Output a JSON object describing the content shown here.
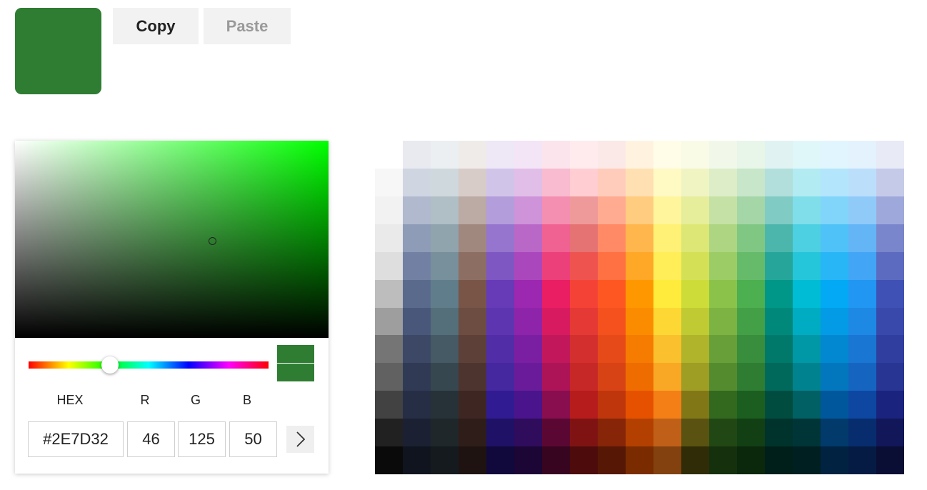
{
  "current_color": "#2E7D32",
  "actions": {
    "copy_label": "Copy",
    "paste_label": "Paste"
  },
  "picker": {
    "hue_color": "#00ff00",
    "hue_level_fraction": 0.34,
    "saturation_fraction": 0.63,
    "value_fraction": 0.49,
    "labels": {
      "hex": "HEX",
      "r": "R",
      "g": "G",
      "b": "B"
    },
    "values": {
      "hex": "#2E7D32",
      "r": "46",
      "g": "125",
      "b": "50"
    },
    "expand_icon": "chevron-right-icon"
  },
  "palette": [
    [
      "#ffffff",
      "#e8eaf0",
      "#eceff1",
      "#efebe9",
      "#ede7f6",
      "#f3e5f5",
      "#fce4ec",
      "#ffebee",
      "#fbe9e7",
      "#fff3e0",
      "#fffde7",
      "#f9fbe7",
      "#f1f8e9",
      "#e8f5e9",
      "#e0f2f1",
      "#e0f7fa",
      "#e1f5fe",
      "#e3f2fd",
      "#e8eaf6"
    ],
    [
      "#f7f7f7",
      "#cfd6e2",
      "#cfd8dc",
      "#d7ccc8",
      "#d1c4e9",
      "#e1bee7",
      "#f8bbd0",
      "#ffcdd2",
      "#ffccbc",
      "#ffe0b2",
      "#fff9c4",
      "#f0f4c3",
      "#dcedc8",
      "#c8e6c9",
      "#b2dfdb",
      "#b2ebf2",
      "#b3e5fc",
      "#bbdefb",
      "#c5cae9"
    ],
    [
      "#f2f2f2",
      "#b0b9cd",
      "#b0bec5",
      "#bcaaa4",
      "#b39ddb",
      "#ce93d8",
      "#f48fb1",
      "#ef9a9a",
      "#ffab91",
      "#ffcc80",
      "#fff59d",
      "#e6ee9c",
      "#c5e1a5",
      "#a5d6a7",
      "#80cbc4",
      "#80deea",
      "#81d4fa",
      "#90caf9",
      "#9fa8da"
    ],
    [
      "#eaeaea",
      "#8f9cb8",
      "#90a4ae",
      "#a1887f",
      "#9575cd",
      "#ba68c8",
      "#f06292",
      "#e57373",
      "#ff8a65",
      "#ffb74d",
      "#fff176",
      "#dce775",
      "#aed581",
      "#81c784",
      "#4db6ac",
      "#4dd0e1",
      "#4fc3f7",
      "#64b5f6",
      "#7986cb"
    ],
    [
      "#dedede",
      "#7281a3",
      "#78909c",
      "#8d6e63",
      "#7e57c2",
      "#ab47bc",
      "#ec407a",
      "#ef5350",
      "#ff7043",
      "#ffa726",
      "#ffee58",
      "#d4e157",
      "#9ccc65",
      "#66bb6a",
      "#26a69a",
      "#26c6da",
      "#29b6f6",
      "#42a5f5",
      "#5c6bc0"
    ],
    [
      "#bdbdbd",
      "#5a6a8c",
      "#607d8b",
      "#795548",
      "#673ab7",
      "#9c27b0",
      "#e91e63",
      "#f44336",
      "#ff5722",
      "#ff9800",
      "#ffeb3b",
      "#cddc39",
      "#8bc34a",
      "#4caf50",
      "#009688",
      "#00bcd4",
      "#03a9f4",
      "#2196f3",
      "#3f51b5"
    ],
    [
      "#9e9e9e",
      "#48577a",
      "#546e7a",
      "#6d4c41",
      "#5e35b1",
      "#8e24aa",
      "#d81b60",
      "#e53935",
      "#f4511e",
      "#fb8c00",
      "#fdd835",
      "#c0ca33",
      "#7cb342",
      "#43a047",
      "#00897b",
      "#00acc1",
      "#039be5",
      "#1e88e5",
      "#3949ab"
    ],
    [
      "#757575",
      "#3c4865",
      "#455a64",
      "#5d4037",
      "#512da8",
      "#7b1fa2",
      "#c2185b",
      "#d32f2f",
      "#e64a19",
      "#f57c00",
      "#fbc02d",
      "#afb42b",
      "#689f38",
      "#388e3c",
      "#00796b",
      "#0097a7",
      "#0288d1",
      "#1976d2",
      "#303f9f"
    ],
    [
      "#616161",
      "#303a54",
      "#37474f",
      "#4e342e",
      "#4527a0",
      "#6a1b9a",
      "#ad1457",
      "#c62828",
      "#d84315",
      "#ef6c00",
      "#f9a825",
      "#9e9d24",
      "#558b2f",
      "#2e7d32",
      "#00695c",
      "#00838f",
      "#0277bd",
      "#1565c0",
      "#283593"
    ],
    [
      "#424242",
      "#262e45",
      "#263238",
      "#3e2723",
      "#311b92",
      "#4a148c",
      "#880e4f",
      "#b71c1c",
      "#bf360c",
      "#e65100",
      "#f57f17",
      "#827717",
      "#33691e",
      "#1b5e20",
      "#004d40",
      "#006064",
      "#01579b",
      "#0d47a1",
      "#1a237e"
    ],
    [
      "#212121",
      "#1b2133",
      "#1f272b",
      "#2f1d1a",
      "#1f1165",
      "#2f0c5c",
      "#5a0833",
      "#7f1313",
      "#862508",
      "#b34000",
      "#c06018",
      "#5a5210",
      "#214814",
      "#123f14",
      "#00332b",
      "#003538",
      "#013a6b",
      "#082d6e",
      "#111758"
    ],
    [
      "#0a0a0a",
      "#10141f",
      "#141a1d",
      "#1f1311",
      "#11093b",
      "#1b0635",
      "#370520",
      "#4d0b0b",
      "#561705",
      "#7a2c00",
      "#82410f",
      "#302c08",
      "#15300d",
      "#0b270c",
      "#001f1a",
      "#001f21",
      "#012341",
      "#051b43",
      "#0a0e34"
    ]
  ]
}
